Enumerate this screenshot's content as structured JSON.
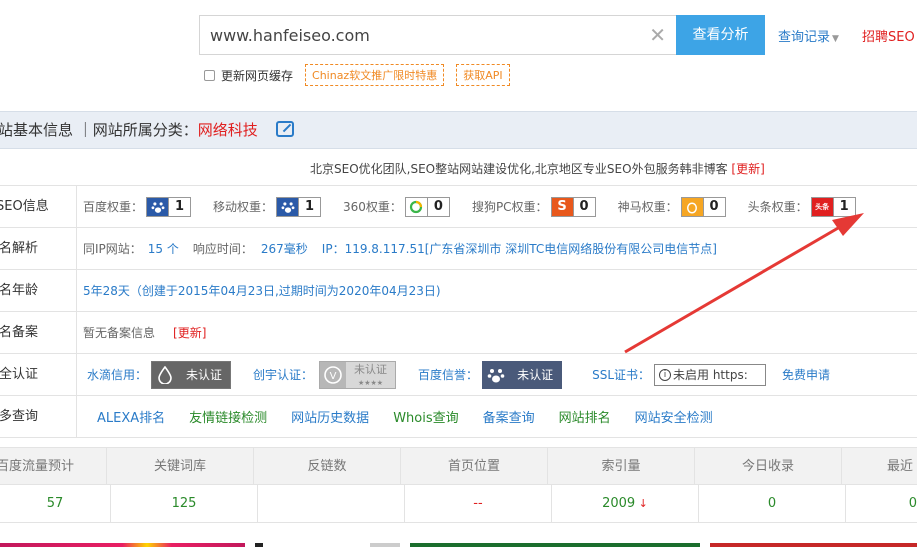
{
  "search": {
    "value": "www.hanfeiseo.com",
    "analyze_label": "查看分析",
    "history_label": "查询记录",
    "hire_label": "招聘SEO"
  },
  "options": {
    "refresh_cache": "更新网页缓存",
    "promo": "Chinaz软文推广限时特惠",
    "api": "获取API"
  },
  "category": {
    "prefix": "站基本信息 ｜网站所属分类：",
    "value": "网络科技"
  },
  "description": {
    "text": "北京SEO优化团队,SEO整站网站建设优化,北京地区专业SEO外包服务韩非博客",
    "update": "[更新]"
  },
  "rows": {
    "seo": {
      "label": "SEO信息",
      "weights": [
        {
          "name": "百度权重：",
          "icon": "baidu-paw-icon",
          "value": "1",
          "color": "#2b5aa8"
        },
        {
          "name": "移动权重：",
          "icon": "baidu-paw-icon",
          "value": "1",
          "color": "#2b5aa8"
        },
        {
          "name": "360权重：",
          "icon": "360-icon",
          "value": "0",
          "color": "#ffffff"
        },
        {
          "name": "搜狗PC权重：",
          "icon": "sogou-icon",
          "value": "0",
          "color": "#e8581c"
        },
        {
          "name": "神马权重：",
          "icon": "shenma-icon",
          "value": "0",
          "color": "#f6a623"
        },
        {
          "name": "头条权重：",
          "icon": "toutiao-icon",
          "value": "1",
          "color": "#e02020"
        }
      ]
    },
    "dns": {
      "label": "域名解析",
      "same_ip_label": "同IP网站：",
      "same_ip_value": "15 个",
      "resp_label": "响应时间：",
      "resp_value": "267毫秒",
      "ip_text": "IP：119.8.117.51[广东省深圳市 深圳TC电信网络股份有限公司电信节点]"
    },
    "age": {
      "label": "域名年龄",
      "value": "5年28天（创建于2015年04月23日,过期时间为2020年04月23日)"
    },
    "icp": {
      "label": "域名备案",
      "value": "暂无备案信息",
      "update": "[更新]"
    },
    "security": {
      "label": "安全认证",
      "shuidi_label": "水滴信用：",
      "shuidi_badge": "未认证",
      "chuangyu_label": "创宇认证：",
      "chuangyu_badge": "未认证",
      "chuangyu_stars": "★★★★",
      "baidu_label": "百度信誉：",
      "baidu_badge": "未认证",
      "ssl_label": "SSL证书：",
      "ssl_value": "未启用 https:",
      "free_apply": "免费申请"
    },
    "more": {
      "label": "更多查询",
      "links": [
        {
          "text": "ALEXA排名",
          "color": "#2a7bc8"
        },
        {
          "text": "友情链接检测",
          "color": "#2a8a2a"
        },
        {
          "text": "网站历史数据",
          "color": "#2a7bc8"
        },
        {
          "text": "Whois查询",
          "color": "#2a8a2a"
        },
        {
          "text": "备案查询",
          "color": "#2a7bc8"
        },
        {
          "text": "网站排名",
          "color": "#2a8a2a"
        },
        {
          "text": "网站安全检测",
          "color": "#2a7bc8"
        }
      ]
    }
  },
  "stats": {
    "headers": [
      "百度流量预计",
      "关键词库",
      "反链数",
      "首页位置",
      "索引量",
      "今日收录",
      "最近"
    ],
    "values": [
      "57",
      "125",
      "",
      "--",
      "2009",
      "0",
      "0"
    ]
  }
}
